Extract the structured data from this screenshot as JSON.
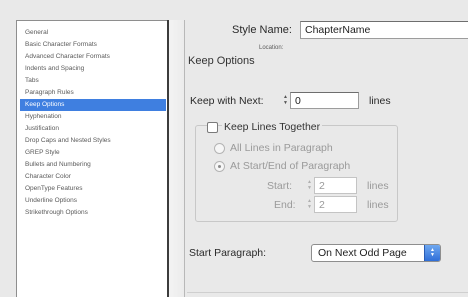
{
  "sidebar": {
    "items": [
      {
        "label": "General"
      },
      {
        "label": "Basic Character Formats"
      },
      {
        "label": "Advanced Character Formats"
      },
      {
        "label": "Indents and Spacing"
      },
      {
        "label": "Tabs"
      },
      {
        "label": "Paragraph Rules"
      },
      {
        "label": "Keep Options",
        "selected": true
      },
      {
        "label": "Hyphenation"
      },
      {
        "label": "Justification"
      },
      {
        "label": "Drop Caps and Nested Styles"
      },
      {
        "label": "GREP Style"
      },
      {
        "label": "Bullets and Numbering"
      },
      {
        "label": "Character Color"
      },
      {
        "label": "OpenType Features"
      },
      {
        "label": "Underline Options"
      },
      {
        "label": "Strikethrough Options"
      }
    ]
  },
  "header": {
    "style_name_label": "Style Name:",
    "style_name_value": "ChapterName",
    "location_label": "Location:",
    "section_title": "Keep Options"
  },
  "keep_with_next": {
    "label": "Keep with Next:",
    "value": "0",
    "unit": "lines"
  },
  "keep_lines_together": {
    "label": "Keep Lines Together",
    "checked": false,
    "option_all": "All Lines in Paragraph",
    "option_start_end": "At Start/End of Paragraph",
    "selected_option": "At Start/End of Paragraph",
    "start_label": "Start:",
    "start_value": "2",
    "start_unit": "lines",
    "end_label": "End:",
    "end_value": "2",
    "end_unit": "lines"
  },
  "start_paragraph": {
    "label": "Start Paragraph:",
    "value": "On Next Odd Page"
  },
  "colors": {
    "selection": "#3f7fe0",
    "popup_arrow": "#2f6ed8"
  }
}
